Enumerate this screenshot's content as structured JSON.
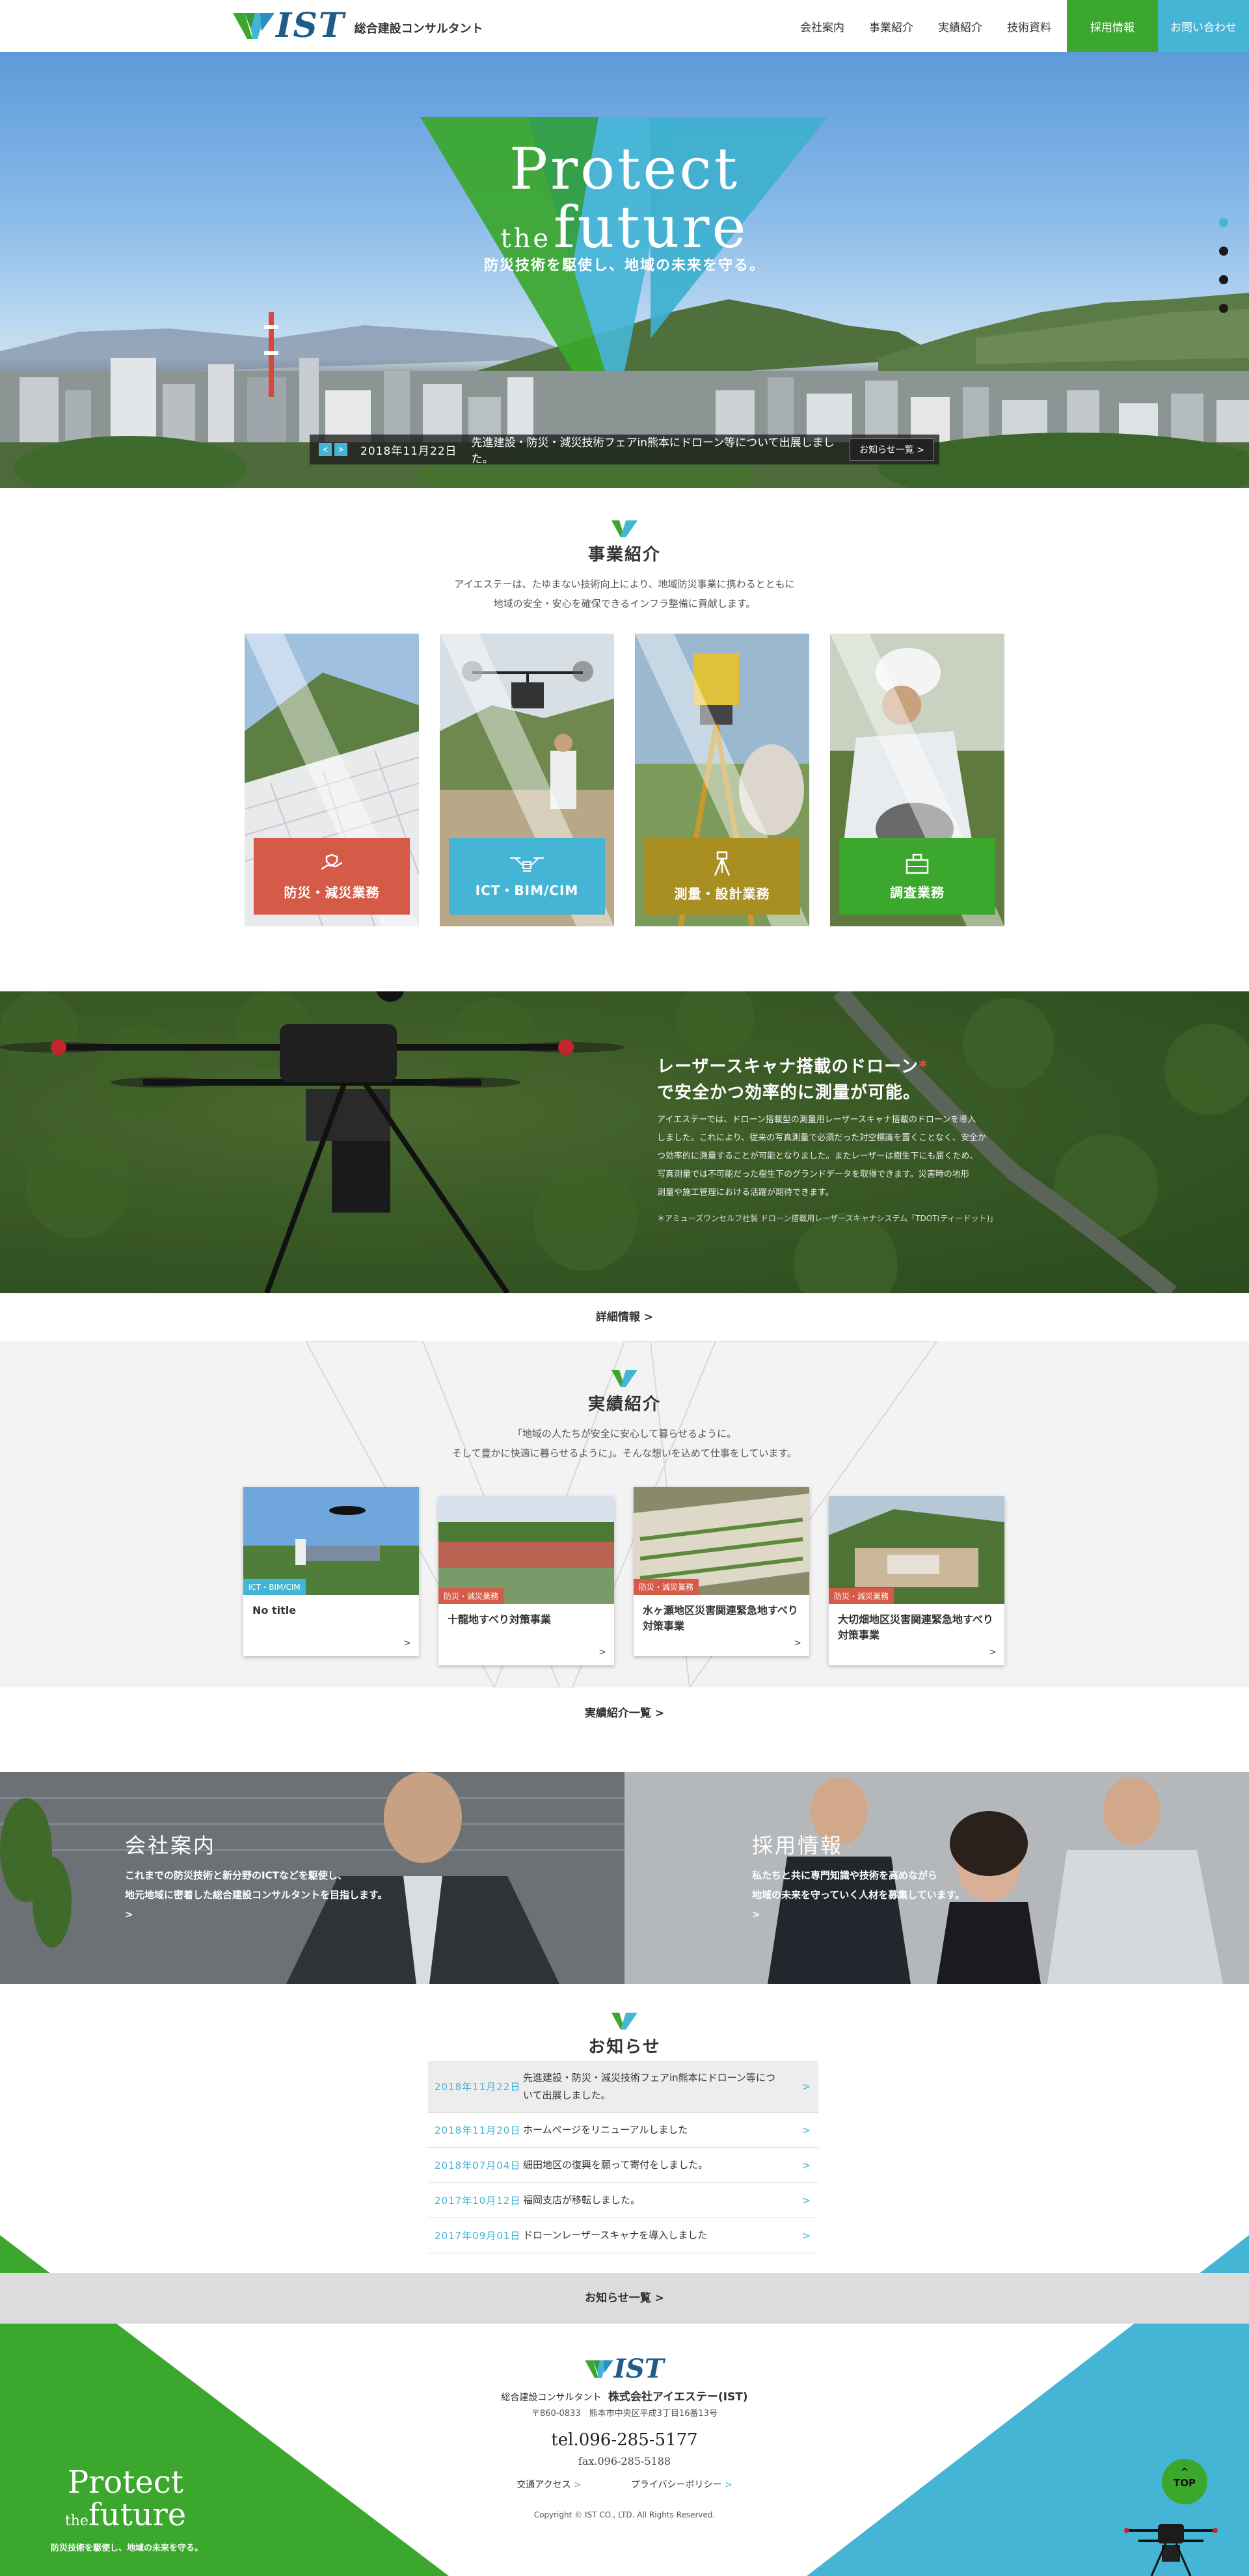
{
  "header": {
    "logo_text": "IST",
    "logo_sub": "総合建設コンサルタント",
    "nav": [
      "会社案内",
      "事業紹介",
      "実績紹介",
      "技術資料"
    ],
    "recruit": "採用情報",
    "contact": "お問い合わせ"
  },
  "hero": {
    "title_line1": "Protect",
    "title_the": "the",
    "title_line2": "future",
    "subtitle": "防災技術を駆使し、地域の未来を守る。",
    "news_prev": "<",
    "news_next": ">",
    "news_date": "2018年11月22日",
    "news_text": "先進建設・防災・減災技術フェアin熊本にドローン等について出展しました。",
    "news_more": "お知らせ一覧 >"
  },
  "business": {
    "title": "事業紹介",
    "desc1": "アイエステーは、たゆまない技術向上により、地域防災事業に携わるとともに",
    "desc2": "地域の安全・安心を確保できるインフラ整備に貢献します。",
    "cards": [
      {
        "label": "防災・減災業務",
        "color": "#d65a48",
        "icon": "hand-shield-icon"
      },
      {
        "label": "ICT・BIM/CIM",
        "color": "#45b5d6",
        "icon": "drone-icon"
      },
      {
        "label": "測量・設計業務",
        "color": "#a98e22",
        "icon": "survey-tripod-icon"
      },
      {
        "label": "調査業務",
        "color": "#3ba72d",
        "icon": "inspection-icon"
      }
    ]
  },
  "drone": {
    "title1": "レーザースキャナ搭載のドローン",
    "asterisk": "*",
    "title2": "で安全かつ効率的に測量が可能。",
    "text1": "アイエステーでは、ドローン搭載型の測量用レーザースキャナ搭載のドローンを導入",
    "text2": "しました。これにより、従来の写真測量で必須だった対空標識を置くことなく、安全か",
    "text3": "つ効率的に測量することが可能となりました。またレーザーは樹生下にも届くため、",
    "text4": "写真測量では不可能だった樹生下のグランドデータを取得できます。災害時の地形",
    "text5": "測量や施工管理における活躍が期待できます。",
    "note": "＊アミューズワンセルフ社製 ドローン搭載用レーザースキャナシステム「TDOT(ティードット)」",
    "detail": "詳細情報 >"
  },
  "works": {
    "title": "実績紹介",
    "desc1": "「地域の人たちが安全に安心して暮らせるように。",
    "desc2": "そして豊かに快適に暮らせるように」。そんな想いを込めて仕事をしています。",
    "cards": [
      {
        "tag": "ICT・BIM/CIM",
        "tag_color": "#45b5d6",
        "title": "No title"
      },
      {
        "tag": "防災・減災業務",
        "tag_color": "#d65a48",
        "title": "十龍地すべり対策事業"
      },
      {
        "tag": "防災・減災業務",
        "tag_color": "#d65a48",
        "title": "水ヶ瀬地区災害関連緊急地すべり対策事業"
      },
      {
        "tag": "防災・減災業務",
        "tag_color": "#d65a48",
        "title": "大切畑地区災害関連緊急地すべり対策事業"
      }
    ],
    "arrow": ">",
    "all": "実績紹介一覧 >"
  },
  "company": {
    "title": "会社案内",
    "text1": "これまでの防災技術と新分野のICTなどを駆使し、",
    "text2": "地元地域に密着した総合建設コンサルタントを目指します。",
    "arrow": ">"
  },
  "recruit": {
    "title": "採用情報",
    "text1": "私たちと共に専門知識や技術を高めながら",
    "text2": "地域の未来を守っていく人材を募集しています。",
    "arrow": ">"
  },
  "news": {
    "title": "お知らせ",
    "items": [
      {
        "date": "2018年11月22日",
        "text": "先進建設・防災・減災技術フェアin熊本にドローン等について出展しました。"
      },
      {
        "date": "2018年11月20日",
        "text": "ホームページをリニューアルしました"
      },
      {
        "date": "2018年07月04日",
        "text": "細田地区の復興を願って寄付をしました。"
      },
      {
        "date": "2017年10月12日",
        "text": "福岡支店が移転しました。"
      },
      {
        "date": "2017年09月01日",
        "text": "ドローンレーザースキャナを導入しました"
      }
    ],
    "arrow": ">",
    "all": "お知らせ一覧 >"
  },
  "footer": {
    "logo_text": "IST",
    "company_prefix": "総合建設コンサルタント",
    "company_name": "株式会社アイエステー(IST)",
    "address": "〒860-0833　熊本市中央区平成3丁目16番13号",
    "tel": "tel.096-285-5177",
    "fax": "fax.096-285-5188",
    "access": "交通アクセス",
    "privacy": "プライバシーポリシー",
    "link_arrow": ">",
    "copyright": "Copyright © IST CO., LTD. All Rights Reserved.",
    "protect1": "Protect",
    "protect_the": "the",
    "protect2": "future",
    "protect_sub": "防災技術を駆使し、地域の未来を守る。",
    "top_arrow": "^",
    "top_label": "TOP"
  },
  "colors": {
    "green": "#3ba72d",
    "blue": "#45b5d6",
    "red": "#d65a48",
    "gold": "#a98e22"
  }
}
